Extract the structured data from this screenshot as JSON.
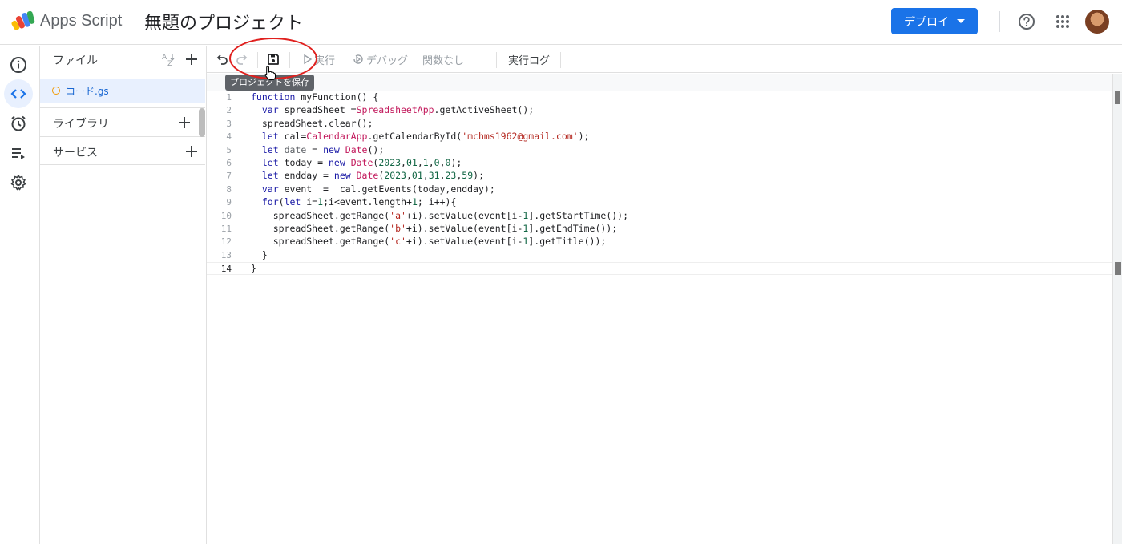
{
  "header": {
    "app_name": "Apps Script",
    "project_title": "無題のプロジェクト",
    "deploy_label": "デプロイ"
  },
  "files": {
    "title": "ファイル",
    "items": [
      {
        "name": "コード.gs"
      }
    ],
    "sections": [
      {
        "label": "ライブラリ"
      },
      {
        "label": "サービス"
      }
    ]
  },
  "toolbar": {
    "run_label": "実行",
    "debug_label": "デバッグ",
    "function_select": "関数なし",
    "log_label": "実行ログ",
    "save_tooltip": "プロジェクトを保存"
  },
  "editor": {
    "line_numbers": [
      "1",
      "2",
      "3",
      "4",
      "5",
      "6",
      "7",
      "8",
      "9",
      "10",
      "11",
      "12",
      "13",
      "14"
    ],
    "lines": [
      "function myFunction() {",
      "  var spreadSheet =SpreadsheetApp.getActiveSheet();",
      "  spreadSheet.clear();",
      "  let cal=CalendarApp.getCalendarById('mchms1962@gmail.com');",
      "  let date = new Date();",
      "  let today = new Date(2023,01,1,0,0);",
      "  let endday = new Date(2023,01,31,23,59);",
      "  var event  =  cal.getEvents(today,endday);",
      "  for(let i=1;i<event.length+1; i++){",
      "    spreadSheet.getRange('a'+i).setValue(event[i-1].getStartTime());",
      "    spreadSheet.getRange('b'+i).setValue(event[i-1].getEndTime());",
      "    spreadSheet.getRange('c'+i).setValue(event[i-1].getTitle());",
      "  }",
      "}"
    ]
  },
  "colors": {
    "accent": "#1a73e8",
    "annotation_circle": "#e0201e",
    "keyword": "#1a1aa6",
    "class_name": "#c2185b",
    "string": "#b3261e",
    "number": "#116644"
  },
  "icons": [
    "apps-script-logo-icon",
    "help-icon",
    "apps-grid-icon",
    "info-icon",
    "code-icon",
    "clock-icon",
    "executions-icon",
    "gear-icon",
    "sort-az-icon",
    "plus-icon",
    "undo-icon",
    "redo-icon",
    "save-icon",
    "play-icon",
    "debug-icon",
    "cursor-icon"
  ]
}
